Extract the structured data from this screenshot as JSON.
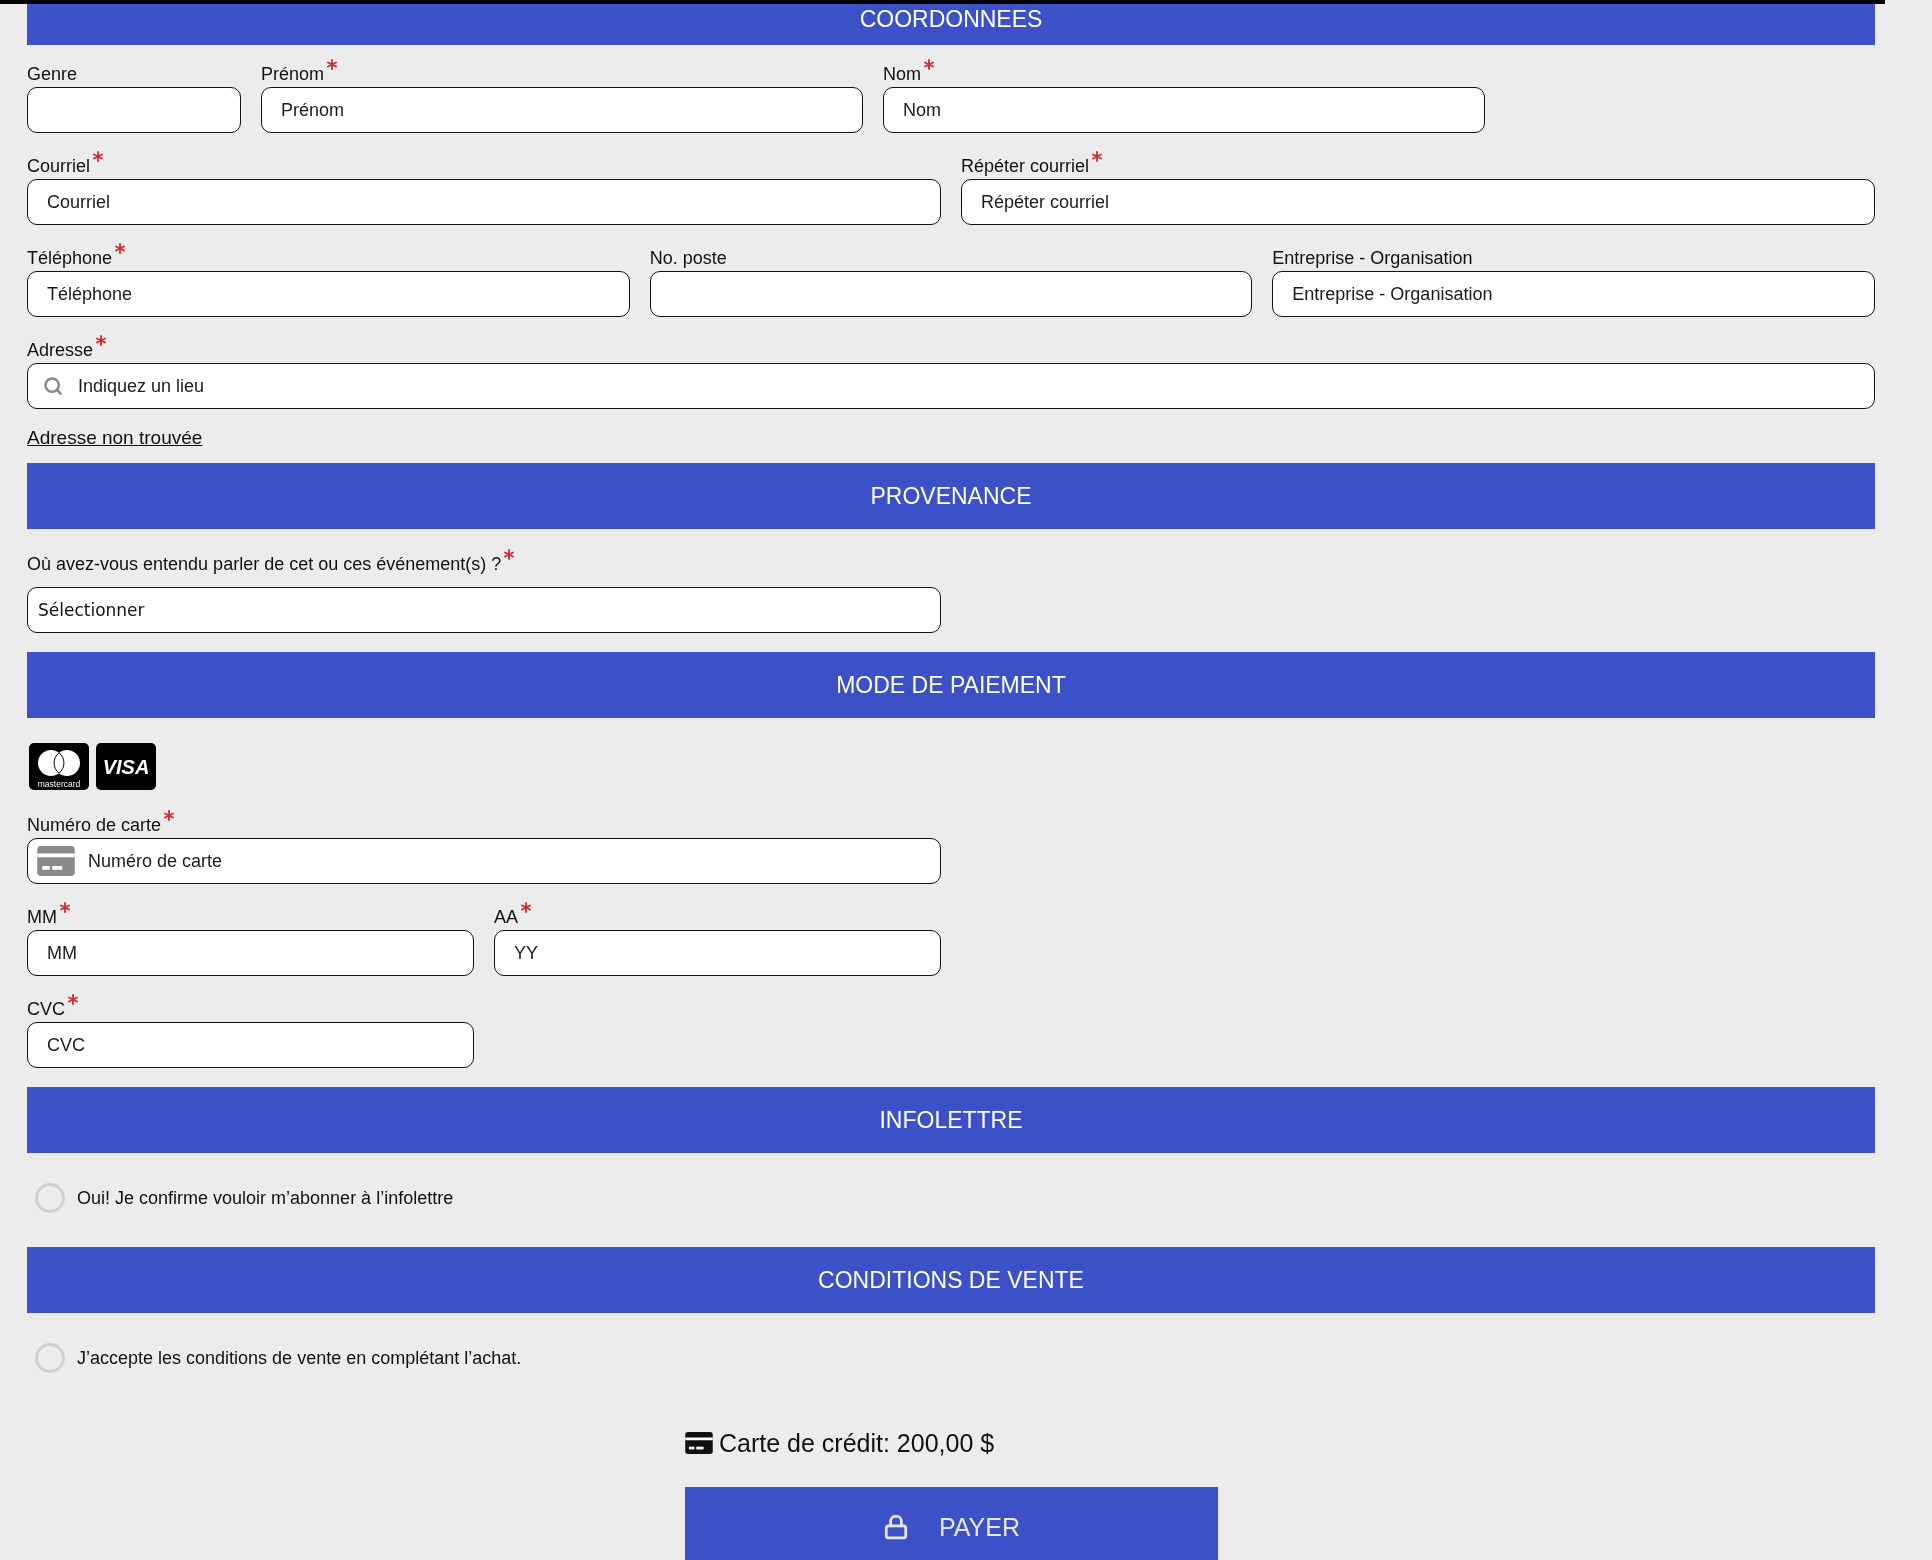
{
  "contact": {
    "title": "COORDONNEES",
    "rows": [
      [
        {
          "label": "Genre",
          "required": false
        },
        {
          "label": "Prénom",
          "required": true,
          "placeholder": "Prénom"
        },
        {
          "label": "Nom",
          "required": true,
          "placeholder": "Nom"
        }
      ],
      [
        {
          "label": "Courriel",
          "required": true,
          "placeholder": "Courriel"
        },
        {
          "label": "Répéter courriel",
          "required": true,
          "placeholder": "Répéter courriel"
        }
      ],
      [
        {
          "label": "Téléphone",
          "required": true,
          "placeholder": "Téléphone"
        },
        {
          "label": "No. poste",
          "required": false
        },
        {
          "label": "Entreprise - Organisation",
          "required": false,
          "placeholder": "Entreprise - Organisation"
        }
      ],
      [
        {
          "label": "Adresse",
          "required": true,
          "placeholder": "Indiquez un lieu",
          "kind": "search"
        }
      ]
    ],
    "link": "Adresse non trouvée"
  },
  "source": {
    "title": "PROVENANCE",
    "question": "Où avez-vous entendu parler de cet ou ces événement(s) ?",
    "required": true,
    "select": "Sélectionner"
  },
  "payment": {
    "title": "MODE DE PAIEMENT",
    "accepted_cards": [
      {
        "kind": "mastercard",
        "caption": "mastercard"
      },
      {
        "kind": "visa",
        "caption": "VISA"
      }
    ],
    "rows": [
      [
        {
          "label": "Numéro de carte",
          "required": true,
          "placeholder": "Numéro de carte",
          "kind": "card"
        }
      ],
      [
        {
          "label": "MM",
          "required": true,
          "placeholder": "MM"
        },
        {
          "label": "AA",
          "required": true,
          "placeholder": "YY"
        }
      ],
      [
        {
          "label": "CVC",
          "required": true,
          "placeholder": "CVC"
        }
      ]
    ]
  },
  "newsletter": {
    "title": "INFOLETTRE",
    "label": "Oui! Je confirme vouloir m’abonner à l’infolettre",
    "checked": false
  },
  "terms": {
    "title": "CONDITIONS DE VENTE",
    "label": "J’accepte les conditions de vente en complétant l’achat.",
    "checked": false
  },
  "total": "Carte de crédit: 200,00 $",
  "pay_button": "PAYER"
}
